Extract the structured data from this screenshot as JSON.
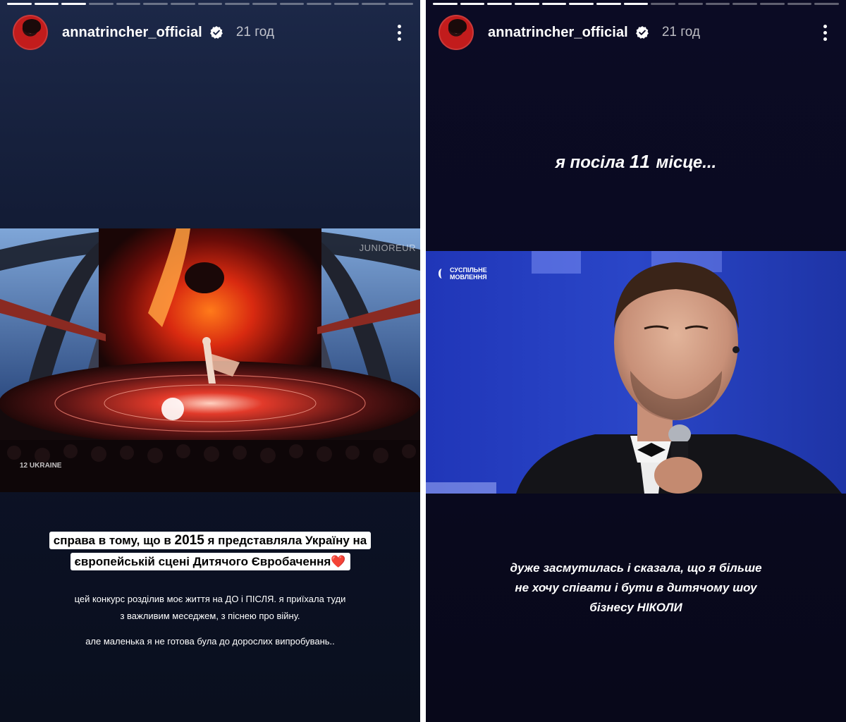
{
  "left_story": {
    "username": "annatrincher_official",
    "time": "21 год",
    "progress_done": 3,
    "progress_total": 15,
    "video": {
      "watermark": "JUNIOREUR",
      "corner_label": "12 UKRAINE"
    },
    "highlight_line1_pre": "справа в тому, що в ",
    "highlight_year": "2015",
    "highlight_line1_post": " я представляла Україну на",
    "highlight_line2": "європейській сцені Дитячого Євробачення",
    "highlight_emoji": "❤️",
    "para1_line1": "цей конкурс розділив моє життя на ДО і ПІСЛЯ. я приїхала туди",
    "para1_line2": "з важливим меседжем, з піснею про війну.",
    "para2": "але маленька я не готова була до дорослих випробувань.."
  },
  "right_story": {
    "username": "annatrincher_official",
    "time": "21 год",
    "progress_done": 8,
    "progress_total": 15,
    "headline_pre": "я посіла ",
    "headline_num": "11",
    "headline_post": " місце...",
    "video": {
      "channel_logo": "СУСПІЛЬНЕ МОВЛЕННЯ"
    },
    "body_line1": "дуже засмутилась і сказала, що я більше",
    "body_line2": "не хочу співати і бути в дитячому шоу",
    "body_line3": "бізнесу НІКОЛИ"
  },
  "colors": {
    "verified_badge": "#ffffff",
    "left_bg": "#131c36",
    "right_bg": "#0a0a20",
    "heart": "#e0202a"
  },
  "icons": [
    "verified-icon",
    "more-options-icon",
    "heart-emoji"
  ]
}
